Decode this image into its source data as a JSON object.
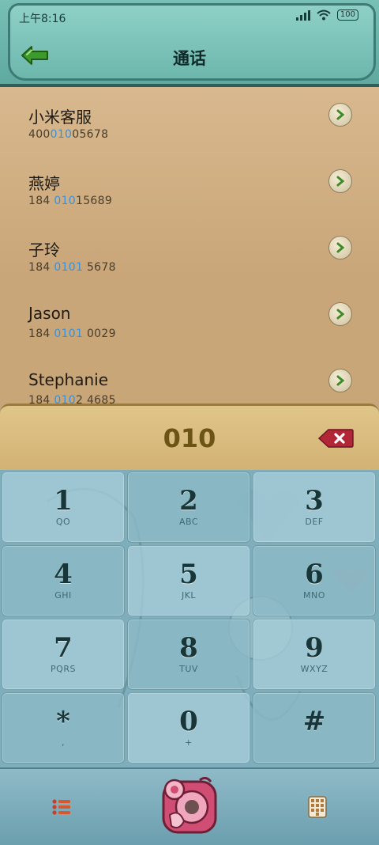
{
  "status": {
    "time": "上午8:16",
    "battery": "100"
  },
  "header": {
    "title": "通话"
  },
  "results": [
    {
      "name": "小米客服",
      "num_pre": "400",
      "num_hl": "010",
      "num_post": "05678"
    },
    {
      "name": "燕婷",
      "num_pre": "184 ",
      "num_hl": "010",
      "num_post": "15689"
    },
    {
      "name": "子玲",
      "num_pre": "184 ",
      "num_hl": "0101",
      "num_post": " 5678"
    },
    {
      "name": "Jason",
      "num_pre": "184 ",
      "num_hl": "0101",
      "num_post": " 0029"
    },
    {
      "name": "Stephanie",
      "num_pre": "184 ",
      "num_hl": "010",
      "num_post": "2 4685"
    }
  ],
  "dial": {
    "input": "010"
  },
  "keys": [
    {
      "digit": "1",
      "letters": "QO"
    },
    {
      "digit": "2",
      "letters": "ABC"
    },
    {
      "digit": "3",
      "letters": "DEF"
    },
    {
      "digit": "4",
      "letters": "GHI"
    },
    {
      "digit": "5",
      "letters": "JKL"
    },
    {
      "digit": "6",
      "letters": "MNO"
    },
    {
      "digit": "7",
      "letters": "PQRS"
    },
    {
      "digit": "8",
      "letters": "TUV"
    },
    {
      "digit": "9",
      "letters": "WXYZ"
    },
    {
      "digit": "*",
      "letters": ","
    },
    {
      "digit": "0",
      "letters": "+"
    },
    {
      "digit": "#",
      "letters": ""
    }
  ],
  "colors": {
    "accent": "#3a90d8",
    "header": "#6db7ad",
    "list_bg": "#c9a679",
    "keypad": "#7eaebb",
    "delete": "#b32638"
  },
  "icons": {
    "back": "back-arrow-icon",
    "row": "chevron-right-icon",
    "delete": "backspace-icon",
    "list": "list-icon",
    "call": "phone-call-icon",
    "grid": "dialpad-icon"
  }
}
